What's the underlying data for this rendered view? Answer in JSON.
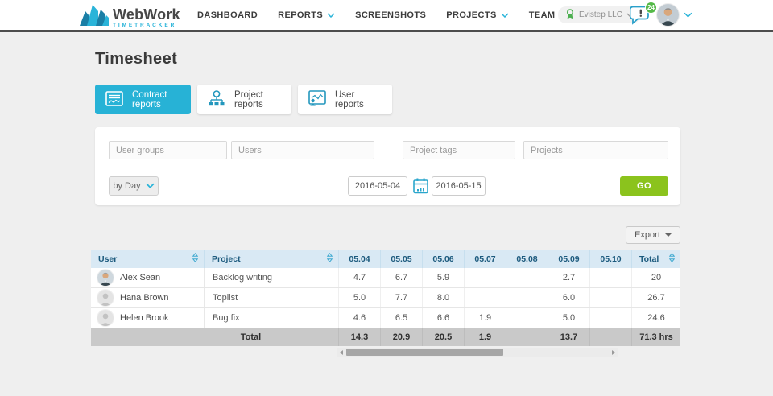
{
  "brand": {
    "name": "WebWork",
    "tagline": "TIMETRACKER"
  },
  "nav": {
    "items": [
      {
        "label": "DASHBOARD",
        "has_dropdown": false
      },
      {
        "label": "REPORTS",
        "has_dropdown": true
      },
      {
        "label": "SCREENSHOTS",
        "has_dropdown": false
      },
      {
        "label": "PROJECTS",
        "has_dropdown": true
      },
      {
        "label": "TEAM",
        "has_dropdown": true
      }
    ]
  },
  "account": {
    "company": "Evistep LLC",
    "notification_count": "24"
  },
  "page": {
    "title": "Timesheet"
  },
  "tabs": [
    {
      "label": "Contract reports",
      "active": true
    },
    {
      "label": "Project reports",
      "active": false
    },
    {
      "label": "User reports",
      "active": false
    }
  ],
  "filters": {
    "user_groups_placeholder": "User groups",
    "users_placeholder": "Users",
    "project_tags_placeholder": "Project tags",
    "projects_placeholder": "Projects",
    "period_label": "by Day",
    "date_from": "2016-05-04",
    "date_to": "2016-05-15",
    "go_label": "GO"
  },
  "export": {
    "label": "Export"
  },
  "table": {
    "columns": [
      "User",
      "Project",
      "05.04",
      "05.05",
      "05.06",
      "05.07",
      "05.08",
      "05.09",
      "05.10",
      "Total"
    ],
    "rows": [
      {
        "user": "Alex Sean",
        "avatar": "photo",
        "project": "Backlog writing",
        "cells": [
          "4.7",
          "6.7",
          "5.9",
          "",
          "",
          "2.7",
          "",
          "20"
        ]
      },
      {
        "user": "Hana Brown",
        "avatar": "placeholder",
        "project": "Toplist",
        "cells": [
          "5.0",
          "7.7",
          "8.0",
          "",
          "",
          "6.0",
          "",
          "26.7"
        ]
      },
      {
        "user": "Helen Brook",
        "avatar": "placeholder",
        "project": "Bug fix",
        "cells": [
          "4.6",
          "6.5",
          "6.6",
          "1.9",
          "",
          "5.0",
          "",
          "24.6"
        ]
      }
    ],
    "total_row": {
      "label": "Total",
      "cells": [
        "14.3",
        "20.9",
        "20.5",
        "1.9",
        "",
        "13.7",
        "",
        "71.3 hrs"
      ]
    }
  },
  "icons": {
    "logo": "zigzag-mountain",
    "nav_dropdown": "chevron-down",
    "company": "award-ribbon",
    "notifications": "chat-bubble",
    "contract_tab": "report-document",
    "project_tab": "org-chart",
    "user_tab": "chart-person",
    "calendar": "calendar",
    "sort": "up-down-arrows",
    "export_caret": "caret-down",
    "scroll_arrows": "left-right-triangles"
  },
  "colors": {
    "accent_cyan": "#27b2d6",
    "go_green": "#8bc31d",
    "badge_green": "#54b948",
    "nav_underline": "#4d4d4d",
    "table_header_bg": "#d9e9f4",
    "table_header_text": "#1c5a7d",
    "total_row_bg": "#c9c9c9",
    "page_bg": "#efefef",
    "logo_dark_blue": "#1b7fa6",
    "logo_light_blue": "#2ab4d9"
  }
}
